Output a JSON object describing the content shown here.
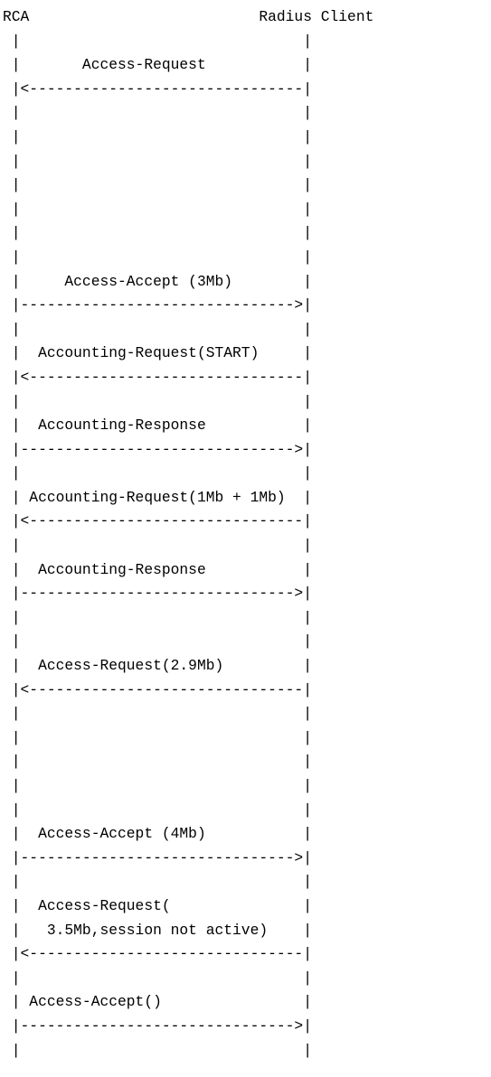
{
  "diagram": {
    "lines": [
      "RCA                          Radius Client",
      " |                                |",
      " |       Access-Request           |",
      " |<-------------------------------|",
      " |                                |",
      " |                                |",
      " |                                |",
      " |                                |",
      " |                                |",
      " |                                |",
      " |                                |",
      " |     Access-Accept (3Mb)        |",
      " |------------------------------->|",
      " |                                |",
      " |  Accounting-Request(START)     |",
      " |<-------------------------------|",
      " |                                |",
      " |  Accounting-Response           |",
      " |------------------------------->|",
      " |                                |",
      " | Accounting-Request(1Mb + 1Mb)  |",
      " |<-------------------------------|",
      " |                                |",
      " |  Accounting-Response           |",
      " |------------------------------->|",
      " |                                |",
      " |                                |",
      " |  Access-Request(2.9Mb)         |",
      " |<-------------------------------|",
      " |                                |",
      " |                                |",
      " |                                |",
      " |                                |",
      " |                                |",
      " |  Access-Accept (4Mb)           |",
      " |------------------------------->|",
      " |                                |",
      " |  Access-Request(               |",
      " |   3.5Mb,session not active)    |",
      " |<-------------------------------|",
      " |                                |",
      " | Access-Accept()                |",
      " |------------------------------->|",
      " |                                |"
    ]
  }
}
